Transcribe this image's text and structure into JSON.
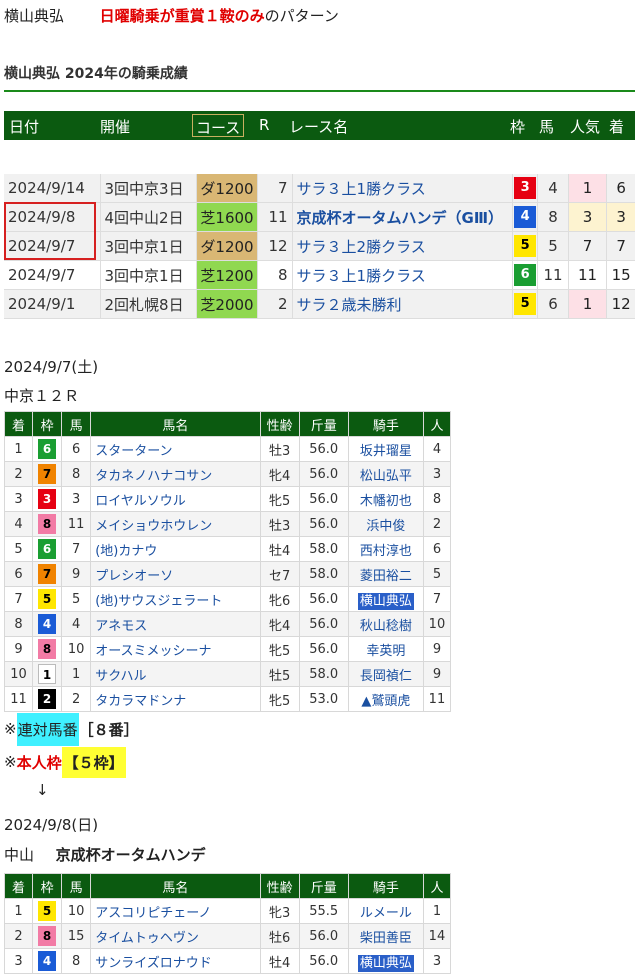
{
  "header": {
    "jockey": "横山典弘",
    "highlight": "日曜騎乗が重賞１鞍のみ",
    "suffix": "のパターン"
  },
  "section_title": "横山典弘 2024年の騎乗成績",
  "summary": {
    "headers": [
      "日付",
      "開催",
      "コース",
      "R",
      "レース名",
      "枠",
      "馬",
      "人気",
      "着"
    ],
    "rows": [
      {
        "date": "2024/9/14",
        "kaisai": "3回中京3日",
        "course": "ダ1200",
        "surface": "dirt",
        "r": "7",
        "race": "サラ３上1勝クラス",
        "bold": false,
        "waku": "3",
        "uma": "4",
        "ninki": "1",
        "chaku": "6"
      },
      {
        "date": "2024/9/8",
        "kaisai": "4回中山2日",
        "course": "芝1600",
        "surface": "turf",
        "r": "11",
        "race": "京成杯オータムハンデ（GⅢ）",
        "bold": true,
        "waku": "4",
        "uma": "8",
        "ninki": "3",
        "chaku": "3"
      },
      {
        "date": "2024/9/7",
        "kaisai": "3回中京1日",
        "course": "ダ1200",
        "surface": "dirt",
        "r": "12",
        "race": "サラ３上2勝クラス",
        "bold": false,
        "waku": "5",
        "uma": "5",
        "ninki": "7",
        "chaku": "7"
      },
      {
        "date": "2024/9/7",
        "kaisai": "3回中京1日",
        "course": "芝1200",
        "surface": "turf",
        "r": "8",
        "race": "サラ３上1勝クラス",
        "bold": false,
        "waku": "6",
        "uma": "11",
        "ninki": "11",
        "chaku": "15"
      },
      {
        "date": "2024/9/1",
        "kaisai": "2回札幌8日",
        "course": "芝2000",
        "surface": "turf",
        "r": "2",
        "race": "サラ２歳未勝利",
        "bold": false,
        "waku": "5",
        "uma": "6",
        "ninki": "1",
        "chaku": "12"
      }
    ]
  },
  "race1": {
    "date": "2024/9/7(土)",
    "name": "中京１２Ｒ",
    "headers": [
      "着",
      "枠",
      "馬",
      "馬名",
      "性齢",
      "斤量",
      "騎手",
      "人"
    ],
    "rows": [
      {
        "chaku": "1",
        "waku": "6",
        "uma": "6",
        "name": "スターターン",
        "sei": "牡3",
        "kin": "56.0",
        "jockey": "坂井瑠星",
        "ninki": "4"
      },
      {
        "chaku": "2",
        "waku": "7",
        "uma": "8",
        "name": "タカネノハナコサン",
        "sei": "牝4",
        "kin": "56.0",
        "jockey": "松山弘平",
        "ninki": "3"
      },
      {
        "chaku": "3",
        "waku": "3",
        "uma": "3",
        "name": "ロイヤルソウル",
        "sei": "牝5",
        "kin": "56.0",
        "jockey": "木幡初也",
        "ninki": "8"
      },
      {
        "chaku": "4",
        "waku": "8",
        "uma": "11",
        "name": "メイショウホウレン",
        "sei": "牡3",
        "kin": "56.0",
        "jockey": "浜中俊",
        "ninki": "2"
      },
      {
        "chaku": "5",
        "waku": "6",
        "uma": "7",
        "name": "(地)カナウ",
        "sei": "牡4",
        "kin": "58.0",
        "jockey": "西村淳也",
        "ninki": "6"
      },
      {
        "chaku": "6",
        "waku": "7",
        "uma": "9",
        "name": "プレシオーソ",
        "sei": "セ7",
        "kin": "58.0",
        "jockey": "菱田裕二",
        "ninki": "5"
      },
      {
        "chaku": "7",
        "waku": "5",
        "uma": "5",
        "name": "(地)サウスジェラート",
        "sei": "牝6",
        "kin": "56.0",
        "jockey": "横山典弘",
        "ninki": "7",
        "hl": true
      },
      {
        "chaku": "8",
        "waku": "4",
        "uma": "4",
        "name": "アネモス",
        "sei": "牝4",
        "kin": "56.0",
        "jockey": "秋山稔樹",
        "ninki": "10"
      },
      {
        "chaku": "9",
        "waku": "8",
        "uma": "10",
        "name": "オースミメッシーナ",
        "sei": "牝5",
        "kin": "56.0",
        "jockey": "幸英明",
        "ninki": "9"
      },
      {
        "chaku": "10",
        "waku": "1",
        "uma": "1",
        "name": "サクハル",
        "sei": "牡5",
        "kin": "58.0",
        "jockey": "長岡禎仁",
        "ninki": "9"
      },
      {
        "chaku": "11",
        "waku": "2",
        "uma": "2",
        "name": "タカラマドンナ",
        "sei": "牝5",
        "kin": "53.0",
        "jockey": "▲鷲頭虎",
        "ninki": "11"
      }
    ]
  },
  "notes": {
    "mark": "※",
    "rentai_label": "連対馬番",
    "rentai_value": "［８番］",
    "honnin_label": "本人枠",
    "honnin_value": "【５枠】",
    "arrow": "↓"
  },
  "race2": {
    "date": "2024/9/8(日)",
    "place": "中山",
    "name": "京成杯オータムハンデ",
    "headers": [
      "着",
      "枠",
      "馬",
      "馬名",
      "性齢",
      "斤量",
      "騎手",
      "人"
    ],
    "rows": [
      {
        "chaku": "1",
        "waku": "5",
        "uma": "10",
        "name": "アスコリピチェーノ",
        "sei": "牝3",
        "kin": "55.5",
        "jockey": "ルメール",
        "ninki": "1"
      },
      {
        "chaku": "2",
        "waku": "8",
        "uma": "15",
        "name": "タイムトゥヘヴン",
        "sei": "牡6",
        "kin": "56.0",
        "jockey": "柴田善臣",
        "ninki": "14"
      },
      {
        "chaku": "3",
        "waku": "4",
        "uma": "8",
        "name": "サンライズロナウド",
        "sei": "牡4",
        "kin": "56.0",
        "jockey": "横山典弘",
        "ninki": "3",
        "hl": true
      }
    ]
  }
}
